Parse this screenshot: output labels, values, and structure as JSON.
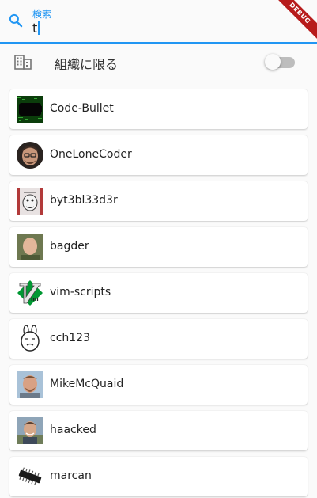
{
  "search": {
    "label": "検索",
    "value": "t"
  },
  "debug_banner": "DEBUG",
  "org_filter": {
    "label": "組織に限る",
    "enabled": false
  },
  "results": [
    {
      "name": "Code-Bullet",
      "avatar_icon": "code-bullet-avatar-icon"
    },
    {
      "name": "OneLoneCoder",
      "avatar_icon": "onelonecoder-avatar-icon"
    },
    {
      "name": "byt3bl33d3r",
      "avatar_icon": "byt3bl33d3r-avatar-icon"
    },
    {
      "name": "bagder",
      "avatar_icon": "bagder-avatar-icon"
    },
    {
      "name": "vim-scripts",
      "avatar_icon": "vim-logo-icon"
    },
    {
      "name": "cch123",
      "avatar_icon": "cartoon-face-icon"
    },
    {
      "name": "MikeMcQuaid",
      "avatar_icon": "mikemcquaid-avatar-icon"
    },
    {
      "name": "haacked",
      "avatar_icon": "haacked-avatar-icon"
    },
    {
      "name": "marcan",
      "avatar_icon": "chip-icon"
    }
  ],
  "colors": {
    "accent": "#2196f3",
    "debug": "#b71c1c",
    "background": "#fafafa"
  }
}
